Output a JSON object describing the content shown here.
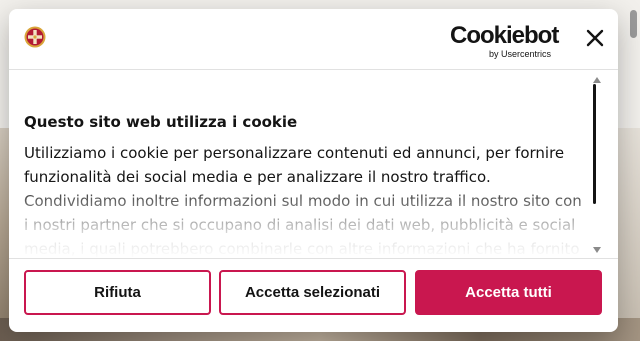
{
  "cookie_dialog": {
    "brand": {
      "name": "Cookiebot",
      "sub": "by Usercentrics"
    },
    "close_label": "×",
    "title": "Questo sito web utilizza i cookie",
    "body": [
      "Utilizziamo i cookie per personalizzare contenuti ed annunci, per fornire funzionalità dei social media e per analizzare il nostro traffico.",
      "Condividiamo inoltre informazioni sul modo in cui utilizza il nostro sito con i nostri partner che si occupano di analisi dei dati web, pubblicità e social media, i quali potrebbero combinarle con altre informazioni che ha fornito"
    ],
    "buttons": {
      "reject": "Rifiuta",
      "accept_selected": "Accetta selezionati",
      "accept_all": "Accetta tutti"
    },
    "colors": {
      "accent": "#c9174f",
      "text": "#141414",
      "logo_cross": "#b31b34",
      "logo_gold": "#d9a53a"
    }
  }
}
